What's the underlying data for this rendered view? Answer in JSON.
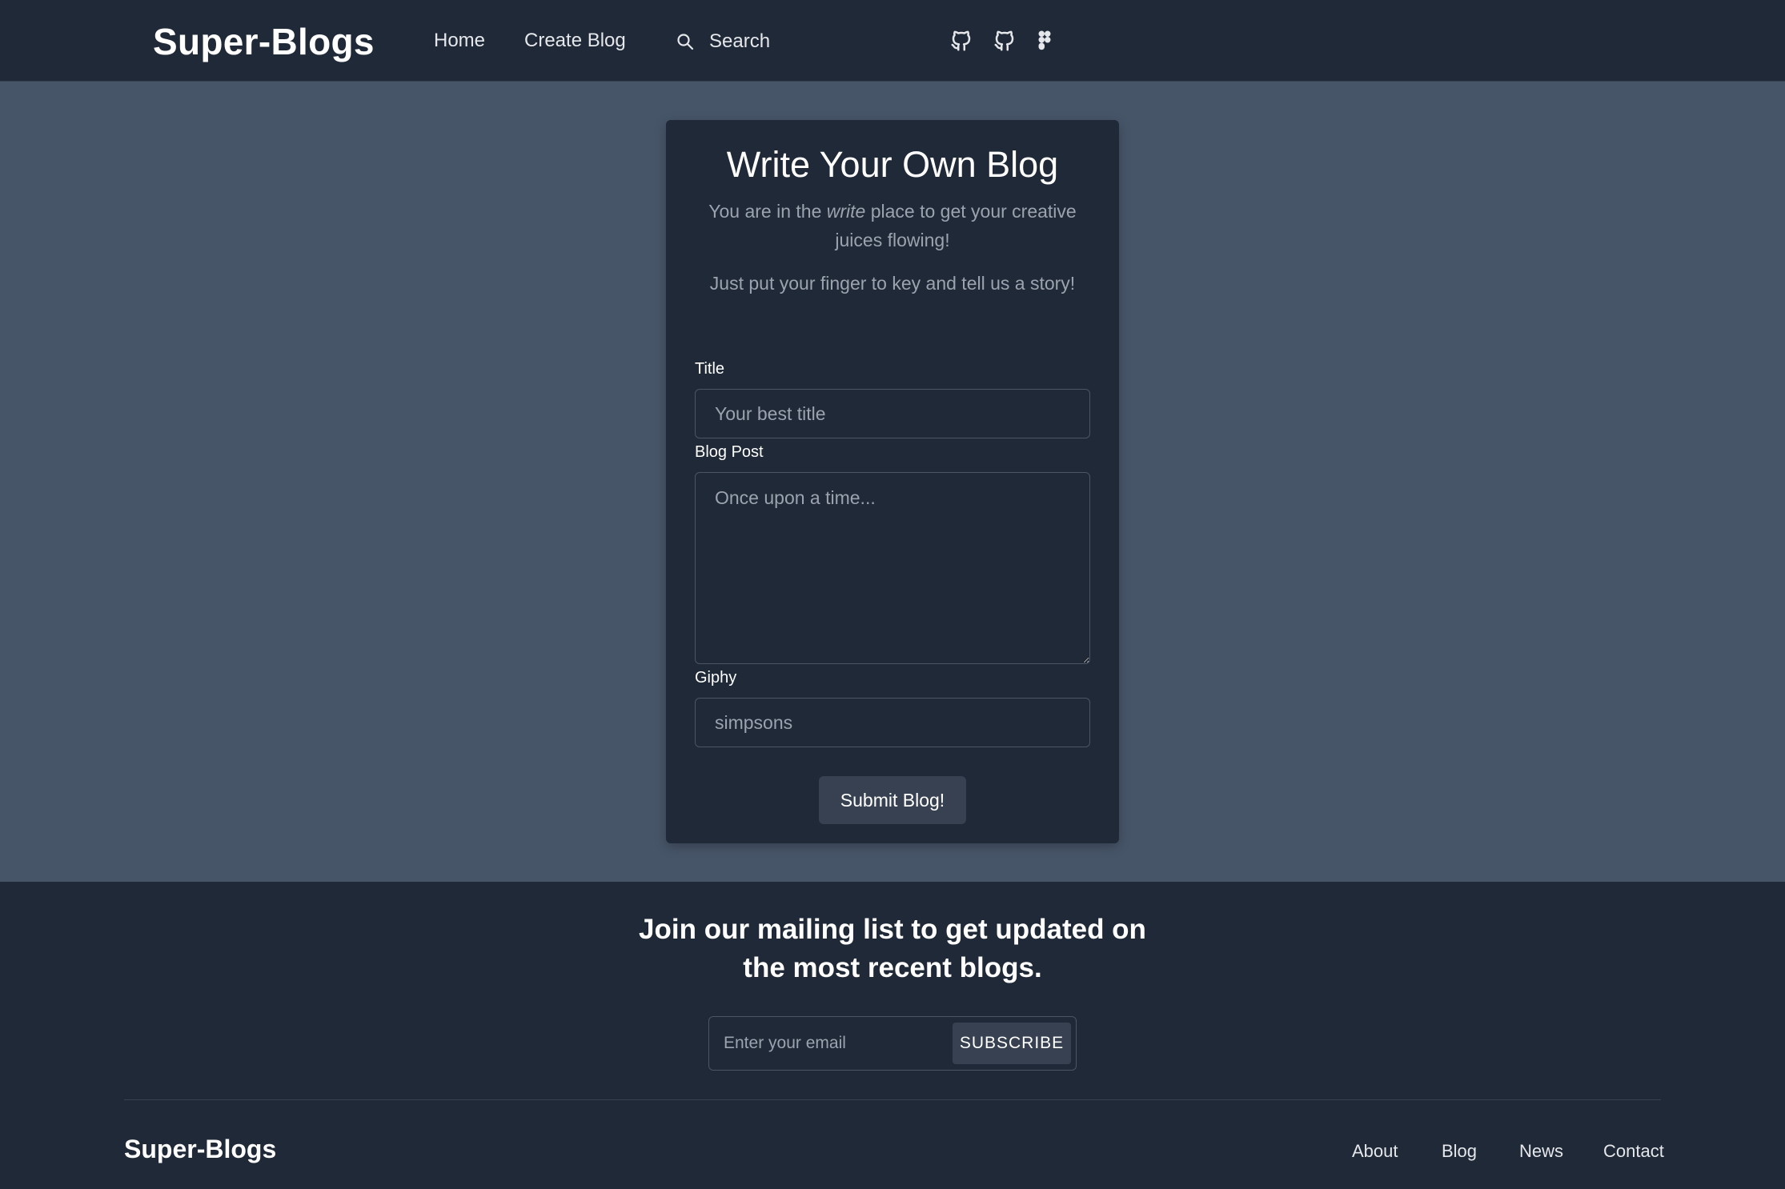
{
  "navbar": {
    "brand": "Super-Blogs",
    "links": [
      {
        "label": "Home"
      },
      {
        "label": "Create Blog"
      }
    ],
    "search": {
      "placeholder": "Search"
    },
    "icons": [
      "github-icon",
      "github-icon",
      "figma-icon"
    ]
  },
  "form": {
    "heading": "Write Your Own Blog",
    "intro_before": "You are in the ",
    "intro_emphasis": "write",
    "intro_after": " place to get your creative juices flowing!",
    "intro2": "Just put your finger to key and tell us a story!",
    "title_label": "Title",
    "title_placeholder": "Your best title",
    "post_label": "Blog Post",
    "post_placeholder": "Once upon a time...",
    "giphy_label": "Giphy",
    "giphy_placeholder": "simpsons",
    "submit_label": "Submit Blog!"
  },
  "footer": {
    "heading": "Join our mailing list to get updated on the most recent blogs.",
    "email_placeholder": "Enter your email",
    "subscribe_label": "SUBSCRIBE",
    "brand": "Super-Blogs",
    "links": [
      {
        "label": "About"
      },
      {
        "label": "Blog"
      },
      {
        "label": "News"
      },
      {
        "label": "Contact"
      }
    ]
  },
  "colors": {
    "page_bg": "#475569",
    "surface": "#1f2937",
    "button": "#374151",
    "muted_text": "#9ca3af"
  }
}
